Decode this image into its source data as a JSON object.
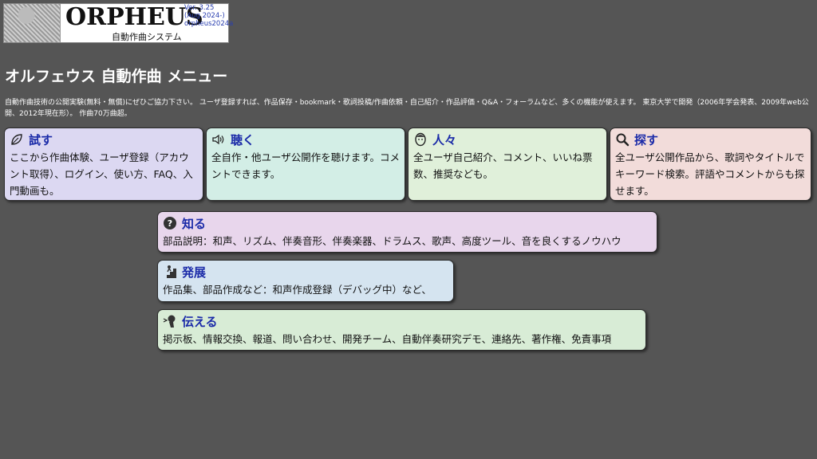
{
  "logo": {
    "wordmark": "ORPHEUS",
    "subtitle": "自動作曲システム",
    "version_lines": [
      "Ver. 3.25",
      "(Aug 2024-)",
      "orpheus2024a"
    ]
  },
  "page": {
    "title": "オルフェウス 自動作曲 メニュー",
    "intro": "自動作曲技術の公開実験(無料・無償)にぜひご協力下さい。 ユーザ登録すれば、作品保存・bookmark・歌詞投稿/作曲依頼・自己紹介・作品評価・Q&A・フォーラムなど、多くの機能が使えます。 東京大学で開発（2006年学会発表、2009年web公開、2012年現在形）。 作曲70万曲超。"
  },
  "menu": [
    {
      "title": "試す",
      "icon": "leaf-icon",
      "desc": "ここから作曲体験、ユーザ登録（アカウント取得）、ログイン、使い方、FAQ、入門動画も。",
      "bg": "#dcd8f2"
    },
    {
      "title": "聴く",
      "icon": "speaker-icon",
      "desc": "全自作・他ユーザ公開作を聴けます。コメントできます。",
      "bg": "#d3eee6"
    },
    {
      "title": "人々",
      "icon": "face-icon",
      "desc": "全ユーザ自己紹介、コメント、いいね票数、推奨なども。",
      "bg": "#e0f0da"
    },
    {
      "title": "探す",
      "icon": "search-icon",
      "desc": "全ユーザ公開作品から、歌詞やタイトルでキーワード検索。評語やコメントからも探せます。",
      "bg": "#f2dcda"
    },
    {
      "title": "知る",
      "icon": "question-icon",
      "desc": "部品説明：和声、リズム、伴奏音形、伴奏楽器、ドラムス、歌声、高度ツール、音を良くするノウハウ",
      "bg": "#e8d6ec"
    },
    {
      "title": "発展",
      "icon": "stairs-icon",
      "desc": "作品集、部品作成など：和声作成登録（デバッグ中）など、",
      "bg": "#d5e4f0"
    },
    {
      "title": "伝える",
      "icon": "speak-icon",
      "desc": "掲示板、情報交換、報道、問い合わせ、開発チーム、自動伴奏研究デモ、連絡先、著作権、免責事項",
      "bg": "#d8ecd6"
    }
  ]
}
